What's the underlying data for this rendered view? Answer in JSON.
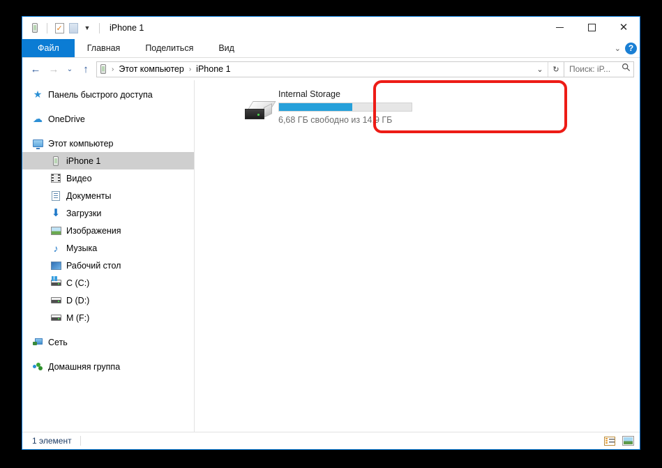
{
  "window": {
    "title": "iPhone 1",
    "quick_access": [
      {
        "name": "device-icon",
        "glyph": "phone"
      },
      {
        "name": "properties-icon",
        "glyph": "checked-doc"
      },
      {
        "name": "new-folder-icon",
        "glyph": "folder"
      },
      {
        "name": "customize-qat-dropdown",
        "glyph": "▾"
      }
    ],
    "controls": {
      "minimize": "minimize",
      "maximize": "maximize",
      "close": "✕"
    }
  },
  "ribbon": {
    "tabs": [
      {
        "label": "Файл",
        "active": true
      },
      {
        "label": "Главная",
        "active": false
      },
      {
        "label": "Поделиться",
        "active": false
      },
      {
        "label": "Вид",
        "active": false
      }
    ],
    "expand_glyph": "⌄",
    "help_glyph": "?"
  },
  "navbar": {
    "back": "←",
    "forward": "→",
    "recent": "⌄",
    "up": "↑",
    "breadcrumbs": [
      "Этот компьютер",
      "iPhone 1"
    ],
    "separator": "›",
    "dropdown_glyph": "⌄",
    "refresh_glyph": "↻"
  },
  "search": {
    "placeholder": "Поиск: iP...",
    "icon": "search-icon"
  },
  "sidebar": {
    "items": [
      {
        "label": "Панель быстрого доступа",
        "icon": "star-icon",
        "level": 0,
        "selected": false
      },
      {
        "label": "OneDrive",
        "icon": "cloud-icon",
        "level": 0,
        "selected": false
      },
      {
        "label": "Этот компьютер",
        "icon": "monitor-icon",
        "level": 0,
        "selected": false
      },
      {
        "label": "iPhone 1",
        "icon": "phone-icon",
        "level": 1,
        "selected": true
      },
      {
        "label": "Видео",
        "icon": "video-icon",
        "level": 1,
        "selected": false
      },
      {
        "label": "Документы",
        "icon": "document-icon",
        "level": 1,
        "selected": false
      },
      {
        "label": "Загрузки",
        "icon": "download-icon",
        "level": 1,
        "selected": false
      },
      {
        "label": "Изображения",
        "icon": "pictures-icon",
        "level": 1,
        "selected": false
      },
      {
        "label": "Музыка",
        "icon": "music-icon",
        "level": 1,
        "selected": false
      },
      {
        "label": "Рабочий стол",
        "icon": "desktop-icon",
        "level": 1,
        "selected": false
      },
      {
        "label": "C (C:)",
        "icon": "windows-drive-icon",
        "level": 1,
        "selected": false
      },
      {
        "label": "D (D:)",
        "icon": "drive-icon",
        "level": 1,
        "selected": false
      },
      {
        "label": "M (F:)",
        "icon": "drive-icon",
        "level": 1,
        "selected": false
      },
      {
        "label": "Сеть",
        "icon": "network-icon",
        "level": 0,
        "selected": false
      },
      {
        "label": "Домашняя группа",
        "icon": "homegroup-icon",
        "level": 0,
        "selected": false
      }
    ]
  },
  "content": {
    "drive": {
      "name": "Internal Storage",
      "capacity_text": "6,68 ГБ свободно из 14,9 ГБ",
      "free_space": "6,68 ГБ",
      "total_space": "14,9 ГБ",
      "used_percent": 55,
      "icon": "internal-storage-icon"
    },
    "highlight_color": "#ed1c16"
  },
  "statusbar": {
    "item_count": "1 элемент",
    "views": [
      {
        "name": "details-view-button",
        "label": "Таблица"
      },
      {
        "name": "large-icons-view-button",
        "label": "Крупные значки"
      }
    ]
  },
  "colors": {
    "accent": "#0b7cd4",
    "progress": "#26a0da",
    "selection": "#cfcfcf",
    "window_border": "#0078d7"
  }
}
